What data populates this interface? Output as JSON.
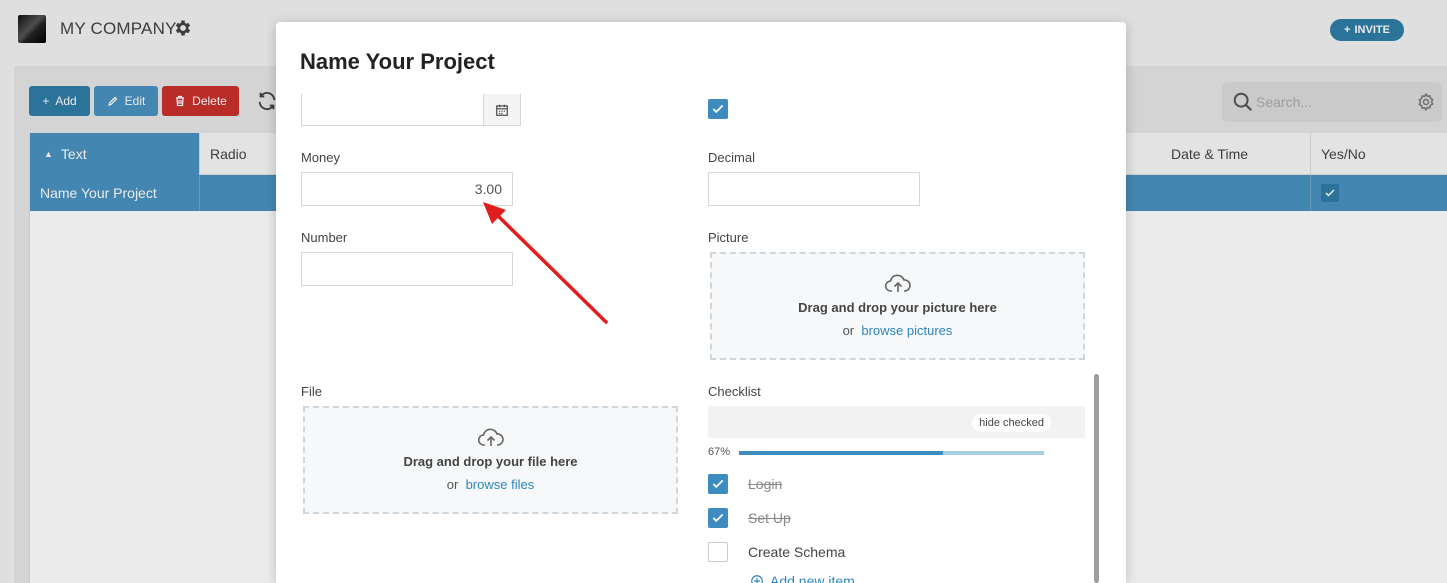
{
  "app": {
    "company_name": "MY COMPANY",
    "invite_label": "INVITE"
  },
  "toolbar": {
    "add_label": "Add",
    "edit_label": "Edit",
    "delete_label": "Delete",
    "search_placeholder": "Search..."
  },
  "grid": {
    "columns": [
      "Text",
      "Radio",
      "Date & Time",
      "Yes/No"
    ],
    "rows": [
      {
        "text": "Name Your Project",
        "radio": "",
        "date_time": "",
        "yes_no": true
      }
    ]
  },
  "modal": {
    "title": "Name Your Project",
    "fields": {
      "money_label": "Money",
      "money_value": "3.00",
      "decimal_label": "Decimal",
      "decimal_value": "",
      "number_label": "Number",
      "number_value": "",
      "picture_label": "Picture",
      "picture_drop_title": "Drag and drop your picture here",
      "picture_or": "or",
      "picture_browse": "browse pictures",
      "file_label": "File",
      "file_drop_title": "Drag and drop your file here",
      "file_or": "or",
      "file_browse": "browse files",
      "top_checkbox_checked": true
    },
    "checklist": {
      "label": "Checklist",
      "hide_checked_label": "hide checked",
      "progress_label": "67%",
      "progress_fraction": 0.67,
      "items": [
        {
          "label": "Login",
          "checked": true
        },
        {
          "label": "Set Up",
          "checked": true
        },
        {
          "label": "Create Schema",
          "checked": false
        }
      ],
      "add_item_label": "Add new item"
    }
  },
  "colors": {
    "accent": "#3d8bbf",
    "primary_dark": "#2f7da7",
    "danger": "#c9302c",
    "annotation_arrow": "#e11d1d"
  }
}
